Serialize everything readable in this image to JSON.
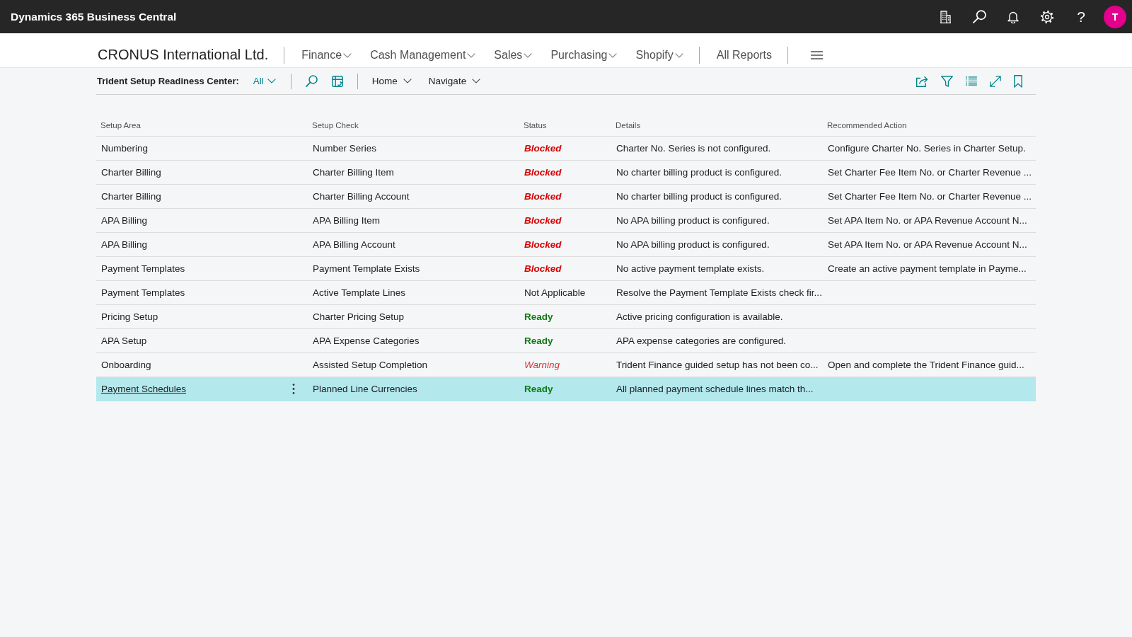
{
  "top_bar": {
    "product_name": "Dynamics 365 Business Central",
    "help_label": "?",
    "user_initial": "T"
  },
  "nav": {
    "company": "CRONUS International Ltd.",
    "menus": [
      "Finance",
      "Cash Management",
      "Sales",
      "Purchasing",
      "Shopify"
    ],
    "reports_link": "All Reports"
  },
  "toolbar": {
    "page_title": "Trident Setup Readiness Center:",
    "view_filter": "All",
    "action_menus": [
      "Home",
      "Navigate"
    ]
  },
  "table": {
    "columns": [
      "Setup Area",
      "Setup Check",
      "Status",
      "Details",
      "Recommended Action"
    ],
    "rows": [
      {
        "setup_area": "Numbering",
        "setup_check": "Number Series",
        "status": {
          "text": "Blocked",
          "kind": "blocked"
        },
        "details": "Charter No. Series is not configured.",
        "recommended_action": "Configure Charter No. Series in Charter Setup.",
        "selected": false
      },
      {
        "setup_area": "Charter Billing",
        "setup_check": "Charter Billing Item",
        "status": {
          "text": "Blocked",
          "kind": "blocked"
        },
        "details": "No charter billing product is configured.",
        "recommended_action": "Set Charter Fee Item No. or Charter Revenue ...",
        "selected": false
      },
      {
        "setup_area": "Charter Billing",
        "setup_check": "Charter Billing Account",
        "status": {
          "text": "Blocked",
          "kind": "blocked"
        },
        "details": "No charter billing product is configured.",
        "recommended_action": "Set Charter Fee Item No. or Charter Revenue ...",
        "selected": false
      },
      {
        "setup_area": "APA Billing",
        "setup_check": "APA Billing Item",
        "status": {
          "text": "Blocked",
          "kind": "blocked"
        },
        "details": "No APA billing product is configured.",
        "recommended_action": "Set APA Item No. or APA Revenue Account N...",
        "selected": false
      },
      {
        "setup_area": "APA Billing",
        "setup_check": "APA Billing Account",
        "status": {
          "text": "Blocked",
          "kind": "blocked"
        },
        "details": "No APA billing product is configured.",
        "recommended_action": "Set APA Item No. or APA Revenue Account N...",
        "selected": false
      },
      {
        "setup_area": "Payment Templates",
        "setup_check": "Payment Template Exists",
        "status": {
          "text": "Blocked",
          "kind": "blocked"
        },
        "details": "No active payment template exists.",
        "recommended_action": "Create an active payment template in Payme...",
        "selected": false
      },
      {
        "setup_area": "Payment Templates",
        "setup_check": "Active Template Lines",
        "status": {
          "text": "Not Applicable",
          "kind": "neutral"
        },
        "details": "Resolve the Payment Template Exists check fir...",
        "selected": false
      },
      {
        "setup_area": "Pricing Setup",
        "setup_check": "Charter Pricing Setup",
        "status": {
          "text": "Ready",
          "kind": "ready"
        },
        "details": "Active pricing configuration is available.",
        "selected": false
      },
      {
        "setup_area": "APA Setup",
        "setup_check": "APA Expense Categories",
        "status": {
          "text": "Ready",
          "kind": "ready"
        },
        "details": "APA expense categories are configured.",
        "selected": false
      },
      {
        "setup_area": "Onboarding",
        "setup_check": "Assisted Setup Completion",
        "status": {
          "text": "Warning",
          "kind": "warning"
        },
        "details": "Trident Finance guided setup has not been co...",
        "recommended_action": "Open and complete the Trident Finance guid...",
        "selected": false
      },
      {
        "setup_area": "Payment Schedules",
        "setup_check": "Planned Line Currencies",
        "status": {
          "text": "Ready",
          "kind": "ready"
        },
        "details": "All planned payment schedule lines match th...",
        "selected": true
      }
    ]
  }
}
